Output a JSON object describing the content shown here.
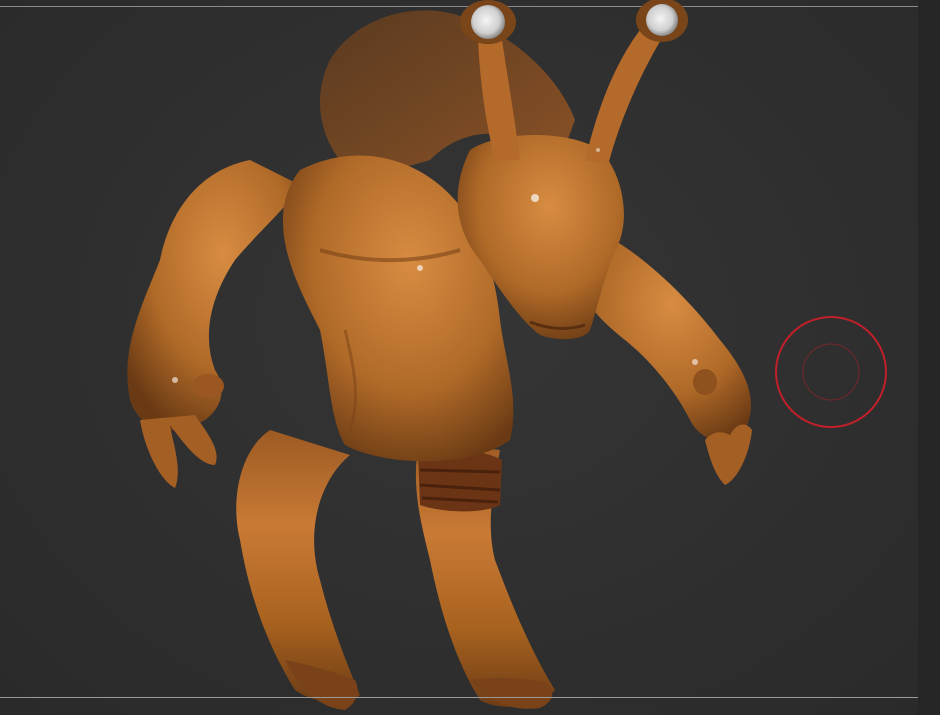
{
  "viewport": {
    "background_color": "#2f2f2f",
    "material_color": "#b36a2a",
    "brush_cursor_color": "#c0202a"
  },
  "model": {
    "icon": "alien-creature-sculpt"
  },
  "brush": {
    "icon": "brush-cursor-icon"
  }
}
